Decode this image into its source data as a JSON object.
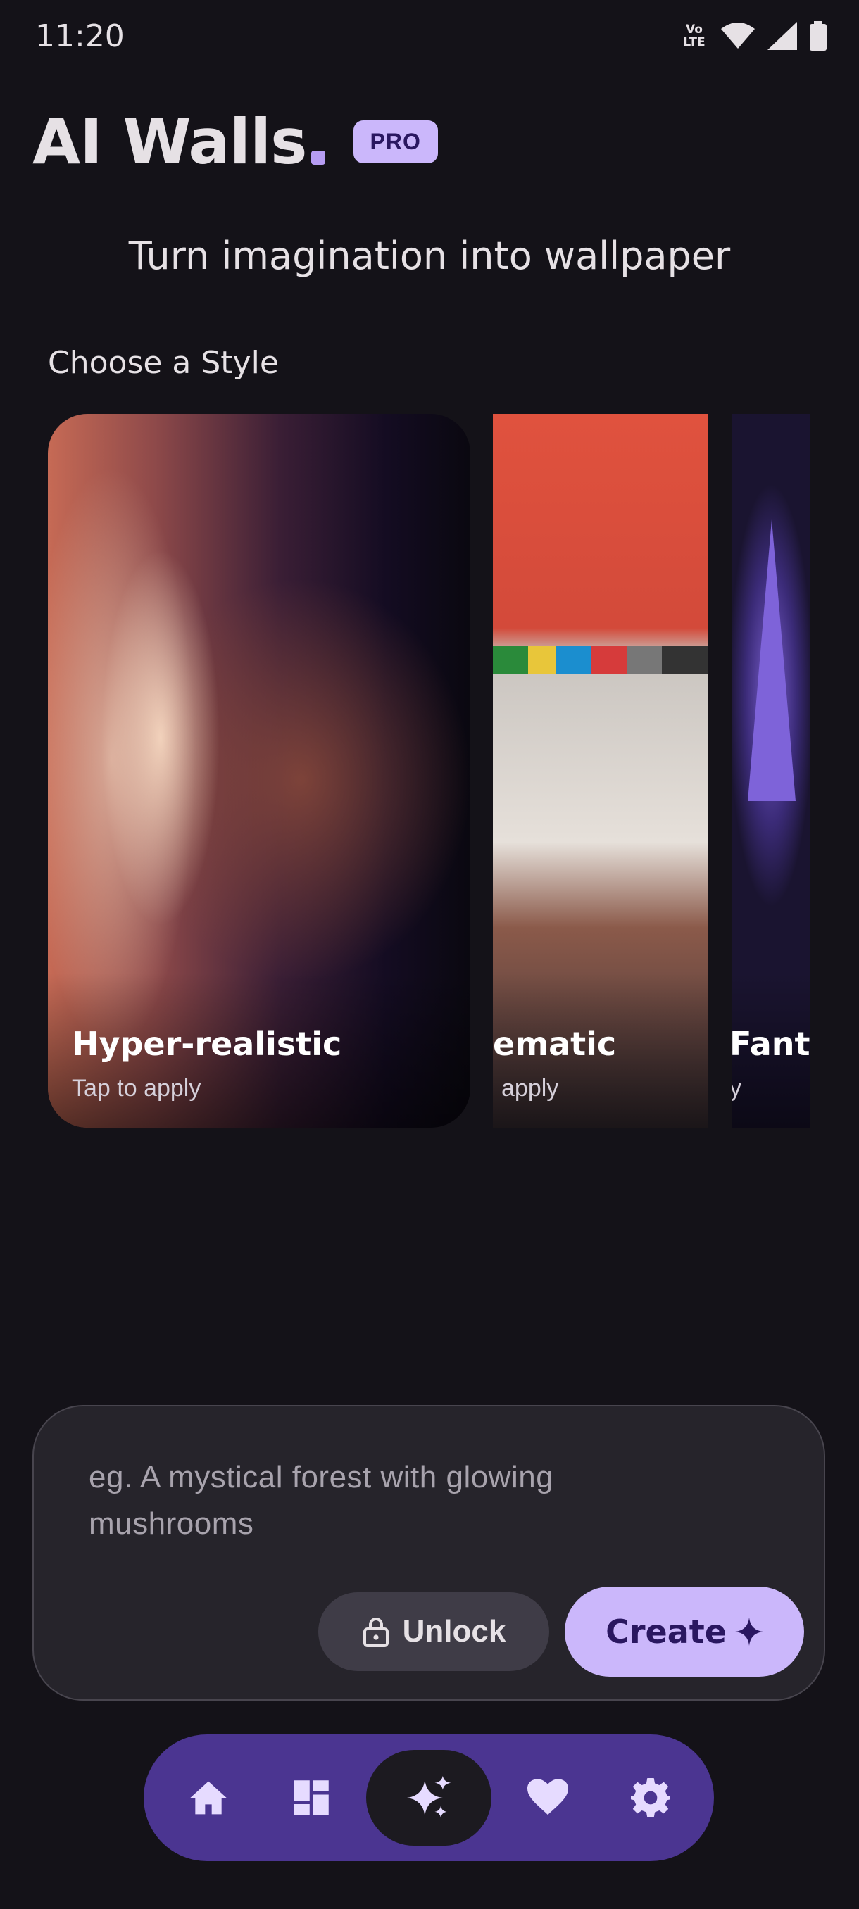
{
  "status_bar": {
    "time": "11:20",
    "network_label": "Vo LTE"
  },
  "header": {
    "app_title": "AI Walls",
    "badge": "PRO"
  },
  "tagline": "Turn imagination into wallpaper",
  "styles_section": {
    "title": "Choose a Style",
    "cards": [
      {
        "name": "Hyper-realistic",
        "subtitle": "Tap to apply"
      },
      {
        "name": "ematic",
        "subtitle": "apply"
      },
      {
        "name": "Fanta",
        "subtitle": "y"
      }
    ]
  },
  "prompt": {
    "placeholder": "eg. A mystical forest with glowing mushrooms",
    "unlock_label": "Unlock",
    "create_label": "Create"
  },
  "bottom_nav": {
    "items": [
      "home-icon",
      "dashboard-icon",
      "sparkles-icon",
      "heart-icon",
      "settings-icon"
    ],
    "active": "sparkles-icon"
  },
  "colors": {
    "background": "#141218",
    "accent": "#cbb7fb",
    "nav": "#4b3591",
    "panel": "#26242b"
  }
}
